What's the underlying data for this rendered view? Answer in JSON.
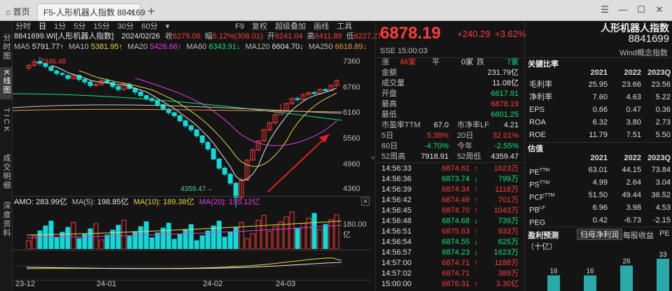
{
  "tabs": {
    "home": "首页",
    "active": "F5-人形机器人指数 884169",
    "add": "+"
  },
  "window": {
    "menu": "☰",
    "min": "—",
    "max": "☐",
    "close": "✕"
  },
  "leftbar": [
    "分时图",
    "K线图",
    "TICK",
    "成交明细",
    "深度资料"
  ],
  "toolbar": {
    "periods": [
      "分时",
      "日",
      "1分",
      "5分",
      "15分",
      "30分",
      "60分"
    ],
    "right": [
      "F9",
      "复权",
      "超级叠加",
      "画线",
      "工具"
    ]
  },
  "info": {
    "code": "8841699.WI[人形机器人指数]",
    "date": "2024/02/26",
    "close_k": "收",
    "close": "6279.06",
    "chg_k": "幅",
    "chg": "5.12%(306.01)",
    "open_k": "开",
    "open": "6241.04",
    "high_k": "高",
    "high": "6411.89",
    "low_k": "低",
    "low": "6227.27"
  },
  "ma": [
    {
      "k": "MA5",
      "v": "5791.77↑"
    },
    {
      "k": "MA10",
      "v": "5381.95↑"
    },
    {
      "k": "MA20",
      "v": "5426.66↑"
    },
    {
      "k": "MA60",
      "v": "6343.91↓"
    },
    {
      "k": "MA120",
      "v": "6604.70↓"
    },
    {
      "k": "MA250",
      "v": "6618.89↓"
    }
  ],
  "yaxis": [
    "7360",
    "6760",
    "6160",
    "5560",
    "4960",
    "4360"
  ],
  "annot": {
    "high": "7346.48",
    "low": "4359.47"
  },
  "amo": {
    "k": "AMO:",
    "v": "283.99亿",
    "ma5_k": "MA(5):",
    "ma5": "198.85亿",
    "ma10_k": "MA(10):",
    "ma10": "189.38亿",
    "ma20_k": "MA(20):",
    "ma20": "155.12亿",
    "ylab": "180.00亿"
  },
  "xaxis": [
    "23-12",
    "24-01",
    "24-02",
    "24-03"
  ],
  "quote": {
    "price": "6878.19",
    "chg": "+240.29",
    "pct": "+3.62%",
    "name": "人形机器人指数",
    "code": "8841699",
    "exch": "SSE",
    "time": "15:00:03",
    "src": "Wind概念指数"
  },
  "breadth": {
    "up_k": "涨",
    "up": "46家",
    "flat_k": "平",
    "flat": "0家",
    "down_k": "跌",
    "down": "7家"
  },
  "stats": [
    {
      "k": "金额",
      "v": "231.79亿",
      "c": "wht"
    },
    {
      "k": "成交量",
      "v": "11.08亿",
      "c": "wht"
    },
    {
      "k": "开盘",
      "v": "6617.91",
      "c": "grn"
    },
    {
      "k": "最高",
      "v": "6878.19",
      "c": "red"
    },
    {
      "k": "最低",
      "v": "6601.25",
      "c": "grn"
    }
  ],
  "stats2": [
    {
      "k1": "市盈率TTM",
      "v1": "67.0",
      "k2": "市净率LF",
      "v2": "4.21",
      "c1": "wht",
      "c2": "wht"
    },
    {
      "k1": "5日",
      "v1": "5.38%",
      "k2": "20日",
      "v2": "32.01%",
      "c1": "red",
      "c2": "red"
    },
    {
      "k1": "60日",
      "v1": "-4.70%",
      "k2": "今年",
      "v2": "-2.55%",
      "c1": "grn",
      "c2": "grn"
    },
    {
      "k1": "52周高",
      "v1": "7918.91",
      "k2": "52周低",
      "v2": "4359.47",
      "c1": "wht",
      "c2": "wht"
    }
  ],
  "ticks": [
    {
      "t": "14:56:33",
      "p": "6874.61",
      "a": "↑",
      "v": "1623万",
      "c": "red"
    },
    {
      "t": "14:56:36",
      "p": "6873.74",
      "a": "↓",
      "v": "799万",
      "c": "grn"
    },
    {
      "t": "14:56:39",
      "p": "6874.34",
      "a": "↑",
      "v": "1118万",
      "c": "red"
    },
    {
      "t": "14:56:42",
      "p": "6874.49",
      "a": "↑",
      "v": "701万",
      "c": "red"
    },
    {
      "t": "14:56:45",
      "p": "6874.70",
      "a": "↑",
      "v": "1043万",
      "c": "red"
    },
    {
      "t": "14:56:48",
      "p": "6874.68",
      "a": "↓",
      "v": "739万",
      "c": "grn"
    },
    {
      "t": "14:56:51",
      "p": "6875.63",
      "a": "↑",
      "v": "933万",
      "c": "red"
    },
    {
      "t": "14:56:54",
      "p": "6874.55",
      "a": "↓",
      "v": "625万",
      "c": "grn"
    },
    {
      "t": "14:56:57",
      "p": "6874.23",
      "a": "↓",
      "v": "1623万",
      "c": "grn"
    },
    {
      "t": "14:57:00",
      "p": "6874.71",
      "a": "↑",
      "v": "1188万",
      "c": "red"
    },
    {
      "t": "14:57:02",
      "p": "6874.71",
      "a": "",
      "v": "389万",
      "c": "red"
    },
    {
      "t": "15:00:00",
      "p": "6876.31",
      "a": "↑",
      "v": "3.30亿",
      "c": "red"
    }
  ],
  "fin": {
    "title": "关键比率",
    "years": [
      "2021",
      "2022",
      "2023Q"
    ],
    "rows": [
      {
        "n": "毛利率",
        "v": [
          "25.95",
          "23.66",
          "23.56"
        ]
      },
      {
        "n": "净利率",
        "v": [
          "7.60",
          "4.63",
          "5.22"
        ]
      },
      {
        "n": "EPS",
        "v": [
          "0.66",
          "0.47",
          "0.36"
        ]
      },
      {
        "n": "ROA",
        "v": [
          "6.32",
          "3.80",
          "2.73"
        ]
      },
      {
        "n": "ROE",
        "v": [
          "11.79",
          "7.51",
          "5.50"
        ]
      }
    ]
  },
  "val": {
    "title": "估值",
    "years": [
      "2021",
      "2022",
      "2023Q"
    ],
    "rows": [
      {
        "n": "PE",
        "sub": "TTM",
        "v": [
          "63.01",
          "44.15",
          "73.84"
        ]
      },
      {
        "n": "PS",
        "sub": "TTM",
        "v": [
          "4.99",
          "2.64",
          "3.04"
        ]
      },
      {
        "n": "PCF",
        "sub": "TTM",
        "v": [
          "51.50",
          "49.44",
          "36.52"
        ]
      },
      {
        "n": "PB",
        "sub": "LF",
        "v": [
          "6.96",
          "3.98",
          "4.53"
        ]
      },
      {
        "n": "PEG",
        "sub": "",
        "v": [
          "0.42",
          "-6.73",
          "-2.15"
        ]
      }
    ]
  },
  "forecast": {
    "title": "盈利预测",
    "tab1": "归母净利润",
    "tab2": "每股收益",
    "tab3": "PE",
    "unit": "（十亿）",
    "bars": [
      {
        "v": 16
      },
      {
        "v": 16
      },
      {
        "v": 26
      },
      {
        "v": 33
      }
    ]
  }
}
